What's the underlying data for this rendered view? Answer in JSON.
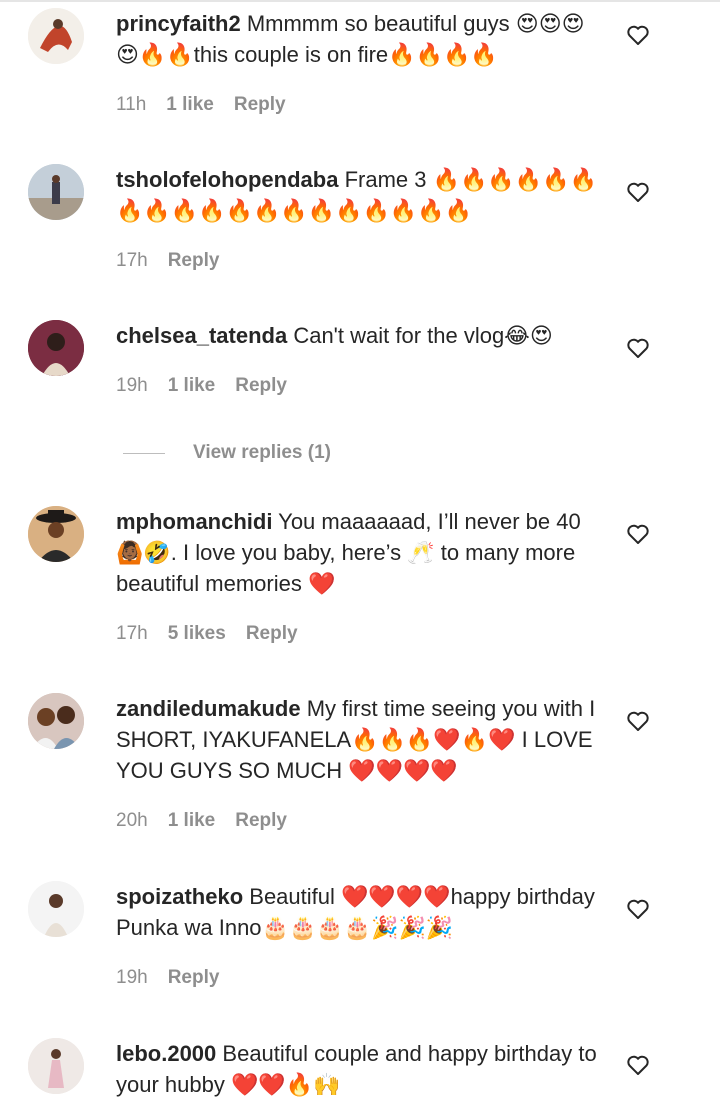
{
  "comments": [
    {
      "username": "princyfaith2",
      "text": "Mmmmm so beautiful guys 😍😍😍😍🔥🔥this couple is on fire🔥🔥🔥🔥",
      "time": "11h",
      "likes": "1 like",
      "reply": "Reply"
    },
    {
      "username": "tsholofelohopendaba",
      "text": "Frame 3 🔥🔥🔥🔥🔥🔥🔥🔥🔥🔥🔥🔥🔥🔥🔥🔥🔥🔥🔥",
      "time": "17h",
      "likes": "",
      "reply": "Reply"
    },
    {
      "username": "chelsea_tatenda",
      "text": "Can't wait for the vlog😂😍",
      "time": "19h",
      "likes": "1 like",
      "reply": "Reply"
    },
    {
      "username": "mphomanchidi",
      "text": "You maaaaaad, I’ll never be 40🙆🏾🤣. I love you baby, here’s 🥂 to many more beautiful memories ❤️",
      "time": "17h",
      "likes": "5 likes",
      "reply": "Reply"
    },
    {
      "username": "zandiledumakude",
      "text": "My first time seeing you with I SHORT, IYAKUFANELA🔥🔥🔥❤️🔥❤️ I LOVE YOU GUYS SO MUCH ❤️❤️❤️❤️",
      "time": "20h",
      "likes": "1 like",
      "reply": "Reply"
    },
    {
      "username": "spoizatheko",
      "text": "Beautiful ❤️❤️❤️❤️happy birthday Punka wa Inno🎂🎂🎂🎂🎉🎉🎉",
      "time": "19h",
      "likes": "",
      "reply": "Reply"
    },
    {
      "username": "lebo.2000",
      "text": "Beautiful couple and happy birthday to your hubby ❤️❤️🔥🙌",
      "time": "",
      "likes": "",
      "reply": ""
    }
  ],
  "view_replies": "View replies (1)"
}
